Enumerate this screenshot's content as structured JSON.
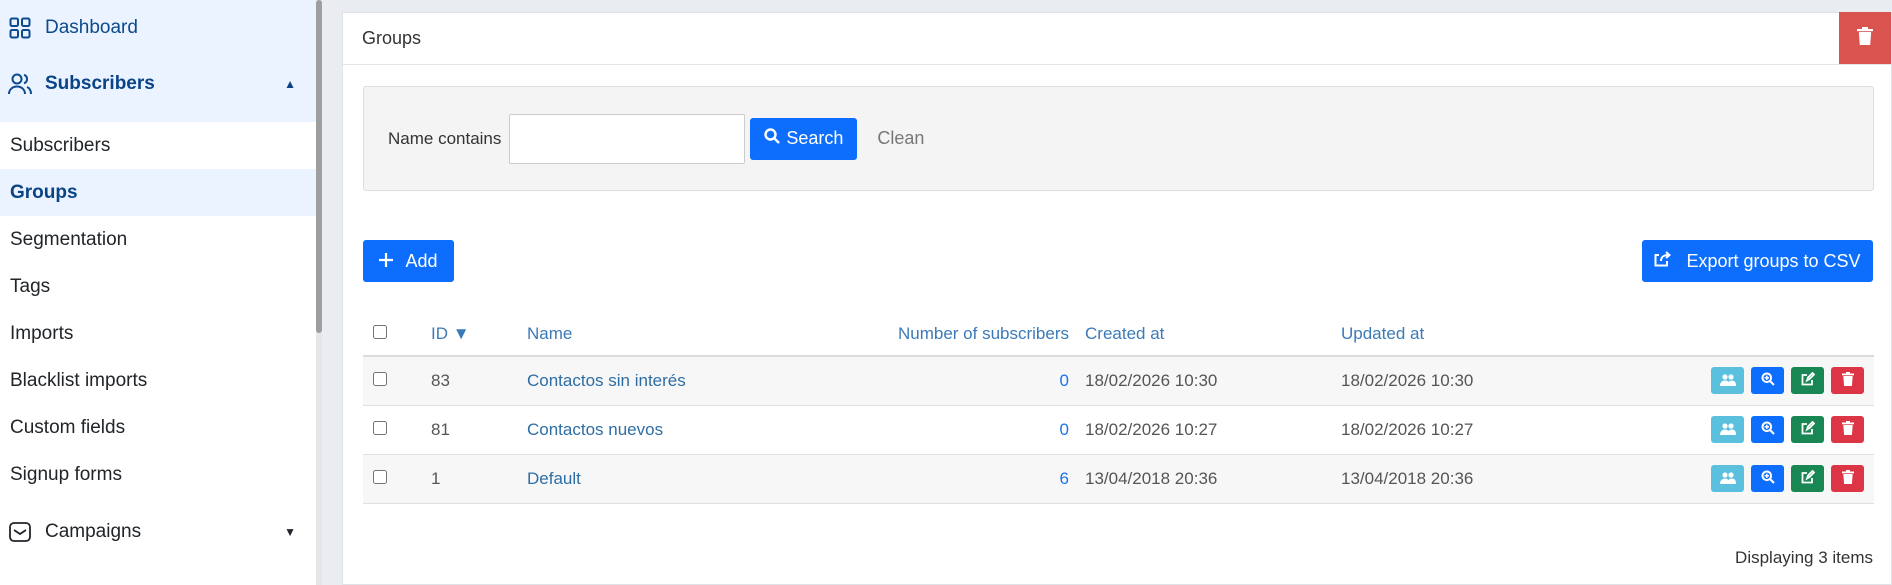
{
  "sidebar": {
    "dashboard_label": "Dashboard",
    "subscribers_label": "Subscribers",
    "items": [
      {
        "label": "Subscribers"
      },
      {
        "label": "Groups"
      },
      {
        "label": "Segmentation"
      },
      {
        "label": "Tags"
      },
      {
        "label": "Imports"
      },
      {
        "label": "Blacklist imports"
      },
      {
        "label": "Custom fields"
      },
      {
        "label": "Signup forms"
      }
    ],
    "campaigns_label": "Campaigns"
  },
  "card": {
    "title": "Groups"
  },
  "filter": {
    "label": "Name contains",
    "value": "",
    "search_label": "Search",
    "clean_label": "Clean"
  },
  "toolbar": {
    "add_label": "Add",
    "export_label": "Export groups to CSV"
  },
  "table": {
    "columns": {
      "id": "ID ▼",
      "name": "Name",
      "subscribers": "Number of subscribers",
      "created": "Created at",
      "updated": "Updated at"
    },
    "rows": [
      {
        "id": "83",
        "name": "Contactos sin interés",
        "subscribers": "0",
        "created": "18/02/2026 10:30",
        "updated": "18/02/2026 10:30"
      },
      {
        "id": "81",
        "name": "Contactos nuevos",
        "subscribers": "0",
        "created": "18/02/2026 10:27",
        "updated": "18/02/2026 10:27"
      },
      {
        "id": "1",
        "name": "Default",
        "subscribers": "6",
        "created": "13/04/2018 20:36",
        "updated": "13/04/2018 20:36"
      }
    ]
  },
  "footer": {
    "summary": "Displaying 3 items"
  },
  "colors": {
    "primary": "#0d6efd",
    "danger": "#dc3545",
    "success": "#198754",
    "info": "#5bc0de",
    "header_delete": "#d9534f"
  }
}
